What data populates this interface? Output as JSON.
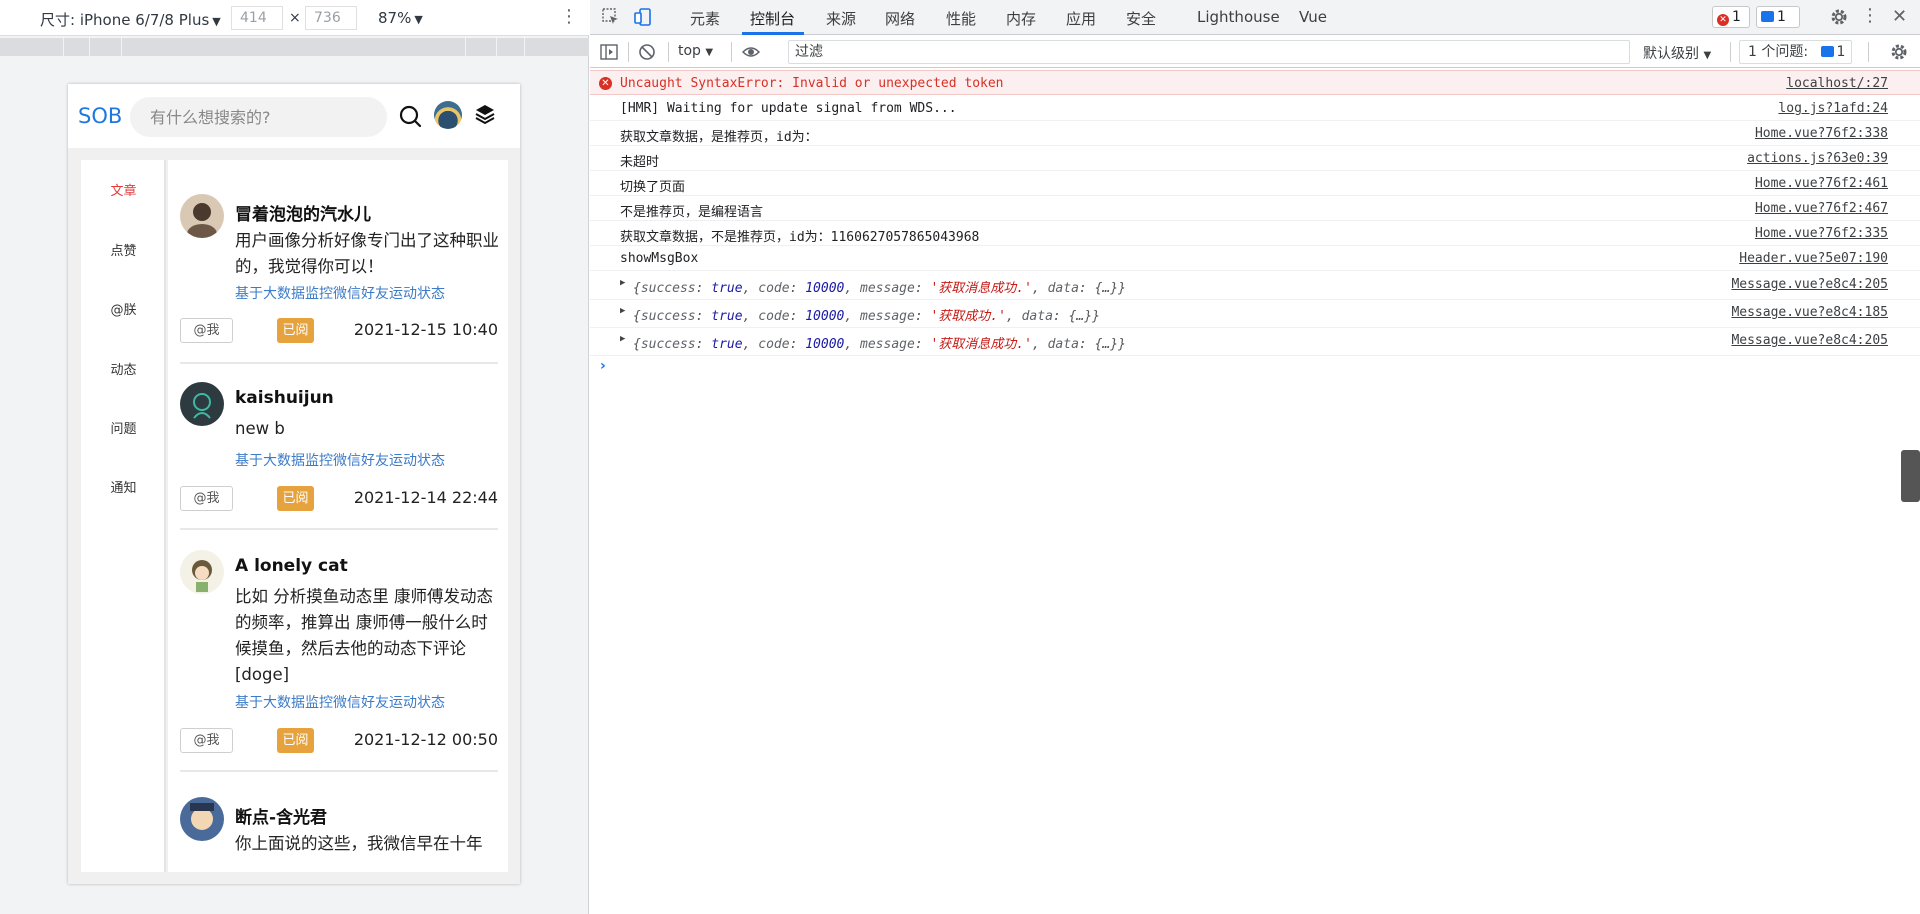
{
  "device_toolbar": {
    "device_label": "尺寸: iPhone 6/7/8 Plus",
    "width": "414",
    "height": "736",
    "times": "×",
    "zoom": "87%"
  },
  "app": {
    "logo": "SOB",
    "search_placeholder": "有什么想搜索的?",
    "nav": [
      "文章",
      "点赞",
      "@朕",
      "动态",
      "问题",
      "通知"
    ],
    "posts": [
      {
        "name": "冒着泡泡的汽水儿",
        "body": "用户画像分析好像专门出了这种职业的，我觉得你可以！",
        "tag": "基于大数据监控微信好友运动状态",
        "at": "@我",
        "read": "已阅",
        "time": "2021-12-15 10:40"
      },
      {
        "name": "kaishuijun",
        "body": "new b",
        "tag": "基于大数据监控微信好友运动状态",
        "at": "@我",
        "read": "已阅",
        "time": "2021-12-14 22:44"
      },
      {
        "name": "A lonely cat",
        "body": "比如 分析摸鱼动态里 康师傅发动态的频率，推算出 康师傅一般什么时候摸鱼，然后去他的动态下评论[doge]",
        "tag": "基于大数据监控微信好友运动状态",
        "at": "@我",
        "read": "已阅",
        "time": "2021-12-12 00:50"
      },
      {
        "name": "断点-含光君",
        "body": "你上面说的这些，我微信早在十年"
      }
    ]
  },
  "devtools": {
    "tabs": [
      "元素",
      "控制台",
      "来源",
      "网络",
      "性能",
      "内存",
      "应用",
      "安全",
      "Lighthouse",
      "Vue"
    ],
    "active_tab": "控制台",
    "error_count": "1",
    "message_count": "1",
    "context": "top",
    "filter_placeholder": "过滤",
    "level": "默认级别",
    "issues_label": "1 个问题:",
    "issues_count": "1",
    "accent": "#1a73e8",
    "error_color": "#d93025",
    "messages": [
      {
        "text": "Uncaught SyntaxError: Invalid or unexpected token",
        "src": "localhost/:27",
        "level": "error"
      },
      {
        "text": "[HMR] Waiting for update signal from WDS...",
        "src": "log.js?1afd:24"
      },
      {
        "text": "获取文章数据，是推荐页，id为：",
        "src": "Home.vue?76f2:338"
      },
      {
        "text": "未超时",
        "src": "actions.js?63e0:39"
      },
      {
        "text": "切换了页面",
        "src": "Home.vue?76f2:461"
      },
      {
        "text": "不是推荐页，是编程语言",
        "src": "Home.vue?76f2:467"
      },
      {
        "text": "获取文章数据，不是推荐页，id为：1160627057865043968",
        "src": "Home.vue?76f2:335"
      },
      {
        "text": "showMsgBox",
        "src": "Header.vue?5e07:190"
      }
    ],
    "objects": [
      {
        "success": "true",
        "code": "10000",
        "message": "'获取消息成功.'",
        "data": "{…}",
        "src": "Message.vue?e8c4:205"
      },
      {
        "success": "true",
        "code": "10000",
        "message": "'获取成功.'",
        "data": "{…}",
        "src": "Message.vue?e8c4:185"
      },
      {
        "success": "true",
        "code": "10000",
        "message": "'获取消息成功.'",
        "data": "{…}",
        "src": "Message.vue?e8c4:205"
      }
    ],
    "prompt": "›"
  }
}
